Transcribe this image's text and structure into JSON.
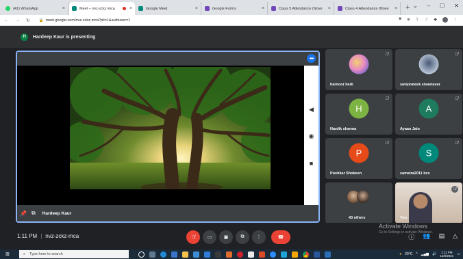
{
  "browser": {
    "tabs": [
      {
        "title": "(41) WhatsApp",
        "color": "#25d366",
        "active": false
      },
      {
        "title": "Meet – nvz-zckz-mca",
        "color": "#00897b",
        "active": true
      },
      {
        "title": "Google Meet",
        "color": "#00897b",
        "active": false
      },
      {
        "title": "Google Forms",
        "color": "#7248b9",
        "active": false
      },
      {
        "title": "Class 5 Attendance (Nove",
        "color": "#7248b9",
        "active": false
      },
      {
        "title": "Class 4 Attendance (Nove",
        "color": "#7248b9",
        "active": false
      }
    ],
    "url": "meet.google.com/nvz-zckz-mca?pli=1&authuser=1"
  },
  "meet": {
    "presenter_initial": "H",
    "presenting_text": "Hardeep Kaur is presenting",
    "presenter_name": "Hardeep Kaur",
    "time": "1:11 PM",
    "meeting_code": "nvz-zckz-mca",
    "participants": [
      {
        "name": "harnoor bedi",
        "initial": "",
        "color": "#e8a0c8"
      },
      {
        "name": "saviprateek sivastavar",
        "initial": "",
        "color": "#9aa7b8"
      },
      {
        "name": "Hardik sharma",
        "initial": "H",
        "color": "#7cb342"
      },
      {
        "name": "Ayaan Jain",
        "initial": "A",
        "color": "#1e7b5e"
      },
      {
        "name": "Pushkar Shokeen",
        "initial": "P",
        "color": "#e64a19"
      },
      {
        "name": "samaira2011 bcs",
        "initial": "S",
        "color": "#00897b"
      },
      {
        "name": "43 others",
        "initial": "",
        "color": "#5f6368"
      },
      {
        "name": "You",
        "initial": "",
        "color": "#c8b8a8"
      }
    ],
    "watermark_line1": "Activate Windows",
    "watermark_line2": "Go to Settings to activate Windows."
  },
  "taskbar": {
    "search_placeholder": "Type here to search",
    "weather": "20°C",
    "clock_time": "1:11 PM",
    "clock_date": "12/9/2021"
  }
}
